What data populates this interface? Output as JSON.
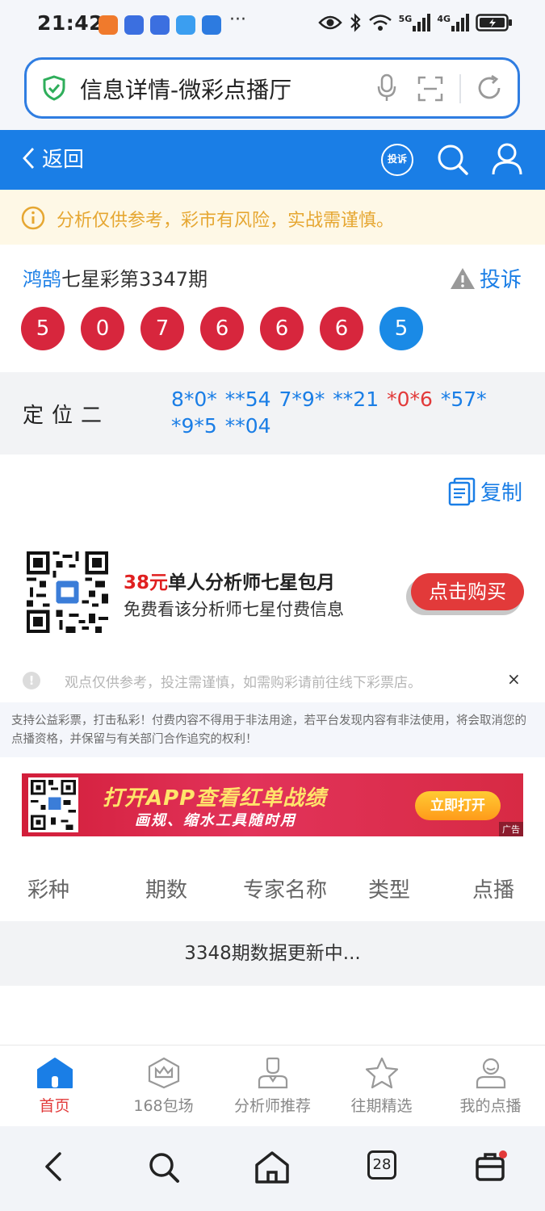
{
  "status_bar": {
    "time": "21:42",
    "more": "···",
    "net_5g": "5G",
    "net_4g": "4G",
    "app_icon_colors": [
      "#f07a2c",
      "#3b6fe0",
      "#3b6fe0",
      "#3b9ef0",
      "#2d7be0"
    ]
  },
  "url_bar": {
    "title": "信息详情-微彩点播厅",
    "icons": [
      "shield-check-icon",
      "mic-icon",
      "scan-icon",
      "refresh-icon"
    ]
  },
  "header": {
    "back_label": "返回",
    "complain_badge": "投诉",
    "icons": [
      "search-icon",
      "user-icon"
    ]
  },
  "notice": {
    "text": "分析仅供参考，彩市有风险，实战需谨慎。"
  },
  "draw": {
    "expert": "鸿鹄",
    "title_rest": "七星彩第3347期",
    "complain_label": "投诉",
    "balls": [
      {
        "value": "5",
        "color": "#d7263d"
      },
      {
        "value": "0",
        "color": "#d7263d"
      },
      {
        "value": "7",
        "color": "#d7263d"
      },
      {
        "value": "6",
        "color": "#d7263d"
      },
      {
        "value": "6",
        "color": "#d7263d"
      },
      {
        "value": "6",
        "color": "#d7263d"
      },
      {
        "value": "5",
        "color": "#1a8ae6"
      }
    ]
  },
  "prediction": {
    "label": "定位二",
    "codes": [
      {
        "text": "8*0*",
        "highlight": false
      },
      {
        "text": "**54",
        "highlight": false
      },
      {
        "text": "7*9*",
        "highlight": false
      },
      {
        "text": "**21",
        "highlight": false
      },
      {
        "text": "*0*6",
        "highlight": true
      },
      {
        "text": "*57*",
        "highlight": false
      },
      {
        "text": "*9*5",
        "highlight": false
      },
      {
        "text": "**04",
        "highlight": false
      }
    ]
  },
  "copy": {
    "label": "复制"
  },
  "promo": {
    "price": "38元",
    "title_rest": "单人分析师七星包月",
    "subtitle": "免费看该分析师七星付费信息",
    "buy_label": "点击购买"
  },
  "tip": {
    "icon": "!",
    "text": "观点仅供参考，投注需谨慎，如需购彩请前往线下彩票店。",
    "close": "×"
  },
  "legal": {
    "text": "支持公益彩票，打击私彩！付费内容不得用于非法用途，若平台发现内容有非法使用，将会取消您的点播资格，并保留与有关部门合作追究的权利！"
  },
  "ad": {
    "title": "打开APP查看红单战绩",
    "subtitle": "画规、缩水工具随时用",
    "button": "立即打开",
    "tag": "广告"
  },
  "table": {
    "headers": [
      "彩种",
      "期数",
      "专家名称",
      "类型",
      "点播"
    ],
    "status": "3348期数据更新中..."
  },
  "tabbar": {
    "tabs": [
      {
        "label": "首页",
        "icon": "home-icon",
        "active": true
      },
      {
        "label": "168包场",
        "icon": "crown-icon",
        "active": false
      },
      {
        "label": "分析师推荐",
        "icon": "analyst-icon",
        "active": false
      },
      {
        "label": "往期精选",
        "icon": "star-icon",
        "active": false
      },
      {
        "label": "我的点播",
        "icon": "profile-icon",
        "active": false
      }
    ]
  },
  "system_nav": {
    "tabs_count": "28",
    "icons": [
      "back-arrow-icon",
      "search-icon",
      "home-icon",
      "tabs-icon",
      "toolbox-icon"
    ]
  }
}
